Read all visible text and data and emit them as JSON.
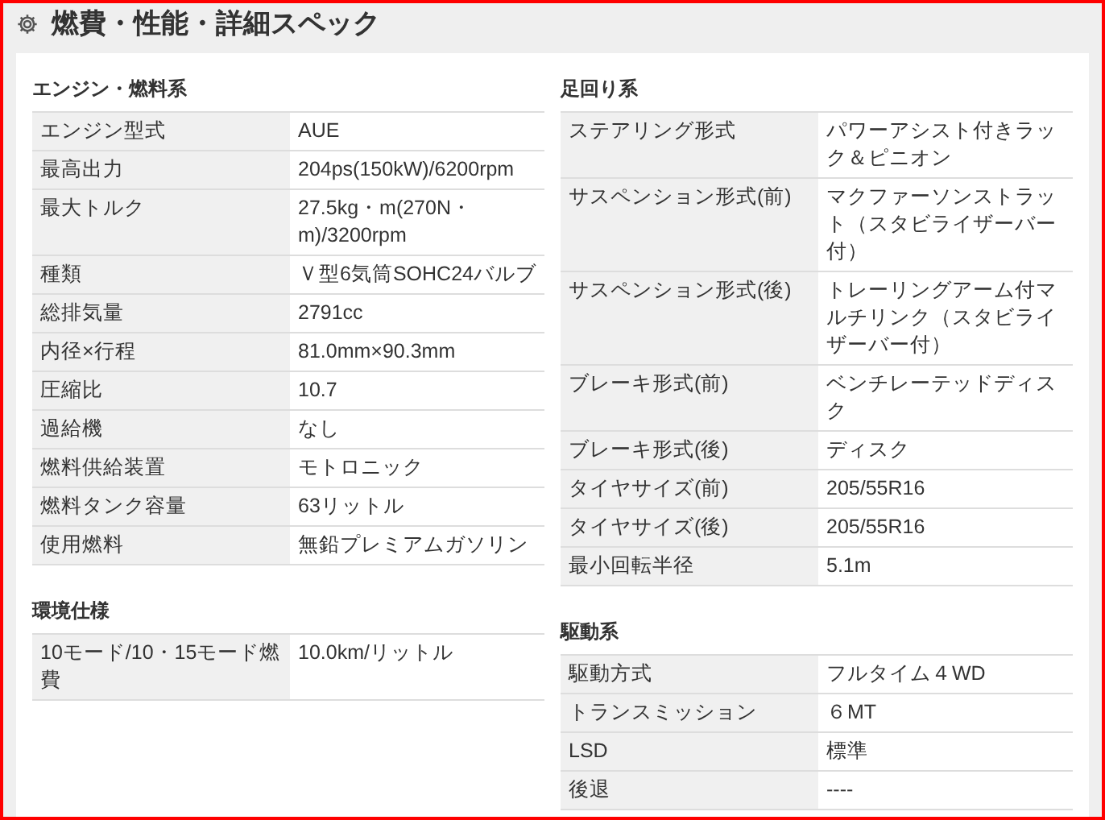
{
  "title": "燃費・性能・詳細スペック",
  "columns": [
    {
      "sections": [
        {
          "heading": "エンジン・燃料系",
          "rows": [
            {
              "label": "エンジン型式",
              "value": "AUE"
            },
            {
              "label": "最高出力",
              "value": "204ps(150kW)/6200rpm"
            },
            {
              "label": "最大トルク",
              "value": "27.5kg・m(270N・m)/3200rpm"
            },
            {
              "label": "種類",
              "value": "Ｖ型6気筒SOHC24バルブ"
            },
            {
              "label": "総排気量",
              "value": "2791cc"
            },
            {
              "label": "内径×行程",
              "value": "81.0mm×90.3mm"
            },
            {
              "label": "圧縮比",
              "value": "10.7"
            },
            {
              "label": "過給機",
              "value": "なし"
            },
            {
              "label": "燃料供給装置",
              "value": "モトロニック"
            },
            {
              "label": "燃料タンク容量",
              "value": "63リットル"
            },
            {
              "label": "使用燃料",
              "value": "無鉛プレミアムガソリン"
            }
          ]
        },
        {
          "heading": "環境仕様",
          "rows": [
            {
              "label": "10モード/10・15モード燃費",
              "value": "10.0km/リットル"
            }
          ]
        }
      ]
    },
    {
      "sections": [
        {
          "heading": "足回り系",
          "rows": [
            {
              "label": "ステアリング形式",
              "value": "パワーアシスト付きラック＆ピニオン"
            },
            {
              "label": "サスペンション形式(前)",
              "value": "マクファーソンストラット（スタビライザーバー付）"
            },
            {
              "label": "サスペンション形式(後)",
              "value": "トレーリングアーム付マルチリンク（スタビライザーバー付）"
            },
            {
              "label": "ブレーキ形式(前)",
              "value": "ベンチレーテッドディスク"
            },
            {
              "label": "ブレーキ形式(後)",
              "value": "ディスク"
            },
            {
              "label": "タイヤサイズ(前)",
              "value": "205/55R16"
            },
            {
              "label": "タイヤサイズ(後)",
              "value": "205/55R16"
            },
            {
              "label": "最小回転半径",
              "value": "5.1m"
            }
          ]
        },
        {
          "heading": "駆動系",
          "rows": [
            {
              "label": "駆動方式",
              "value": "フルタイム４WD"
            },
            {
              "label": "トランスミッション",
              "value": "６MT"
            },
            {
              "label": "LSD",
              "value": "標準"
            },
            {
              "label": "後退",
              "value": "----"
            }
          ]
        }
      ]
    }
  ]
}
